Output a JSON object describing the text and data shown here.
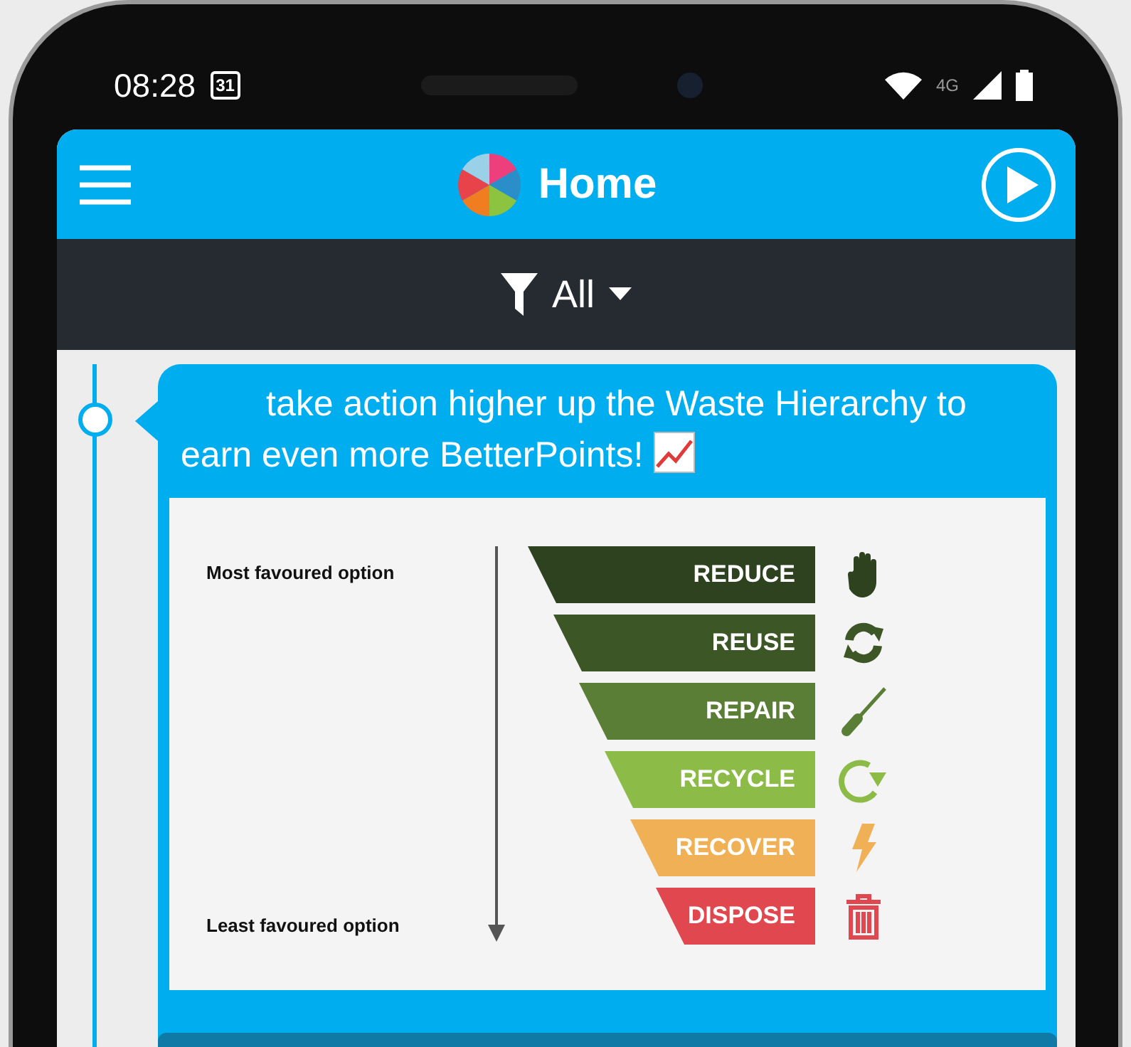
{
  "status_bar": {
    "time": "08:28",
    "calendar_day": "31",
    "network": "4G"
  },
  "app_bar": {
    "title": "Home"
  },
  "filter": {
    "label": "All"
  },
  "post": {
    "text": "take action higher up the Waste Hierarchy to earn even more BetterPoints!",
    "infographic": {
      "top_label": "Most favoured option",
      "bottom_label": "Least favoured option",
      "tiers": [
        {
          "label": "REDUCE",
          "color": "#2f4220"
        },
        {
          "label": "REUSE",
          "color": "#3d5626"
        },
        {
          "label": "REPAIR",
          "color": "#5b7e36"
        },
        {
          "label": "RECYCLE",
          "color": "#8dbb48"
        },
        {
          "label": "RECOVER",
          "color": "#f0b055"
        },
        {
          "label": "DISPOSE",
          "color": "#e0474f"
        }
      ]
    }
  }
}
